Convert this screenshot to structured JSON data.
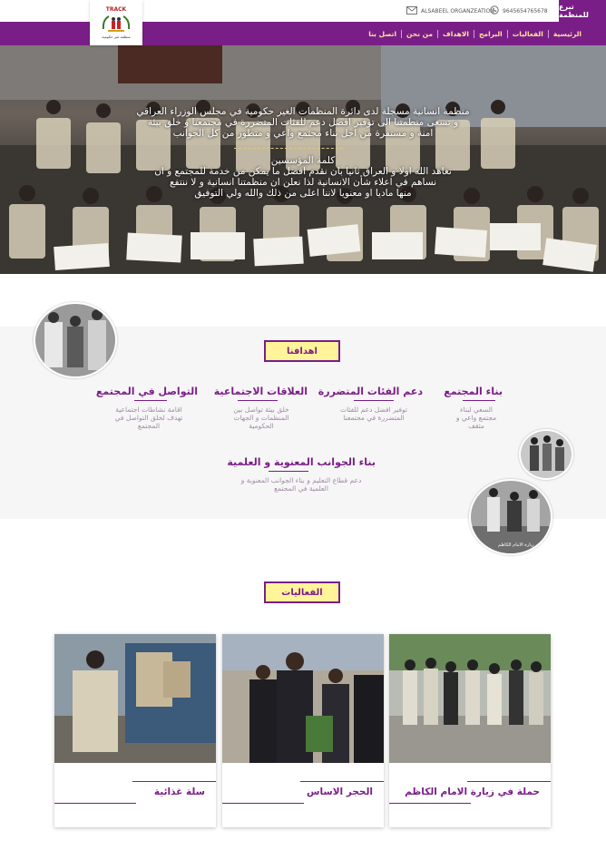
{
  "header": {
    "donate_label": "تبرع للمنظمة",
    "phone": "9645654765678",
    "email": "ALSABEEL ORGANZEATION",
    "logo_text": "TRACK",
    "logo_subtext": "منظمة غير حكومية"
  },
  "nav": {
    "items": [
      "الرئيسية",
      "الفعاليات",
      "البرامج",
      "الاهداف",
      "من نحن",
      "اتصل بنا"
    ]
  },
  "hero": {
    "mission_lines": [
      "منظمة انسانية مسجلة لدى دائرة المنظمات الغير حكومية في مجلس الوزراء العراقي",
      "و تسعى منظمتنا الى توفير افضل دعم للفئات المتضررة في مجتمعنا و خلق بيئة",
      "امنة و مستقرة من اجل بناء مجتمع واعي و متطور من كل الجوانب"
    ],
    "founder_title": "كلمة المؤسسين",
    "founder_lines": [
      "نعاهد الله اولا و العراق ثانيا بان نقدم افضل ما يمكن من خدمة للمجتمع و ان",
      "نساهم في اعلاء شأن الانسانية لذا نعلن ان منظمتنا انسانية و لا ننتفع",
      "منها ماديا او معنويا لاننا اعلى من ذلك والله ولي التوفيق"
    ]
  },
  "goals": {
    "section_label": "اهدافنا",
    "items": [
      {
        "title": "بناء المجتمع",
        "desc": [
          "السعي لبناء",
          "مجتمع واعي و",
          "مثقف"
        ]
      },
      {
        "title": "دعم الفئات المتضررة",
        "desc": [
          "توفير افضل دعم للفئات",
          "المتضررة في مجتمعنا"
        ]
      },
      {
        "title": "العلاقات الاجتماعية",
        "desc": [
          "خلق بيئة تواصل بين",
          "المنظمات و الجهات",
          "الحكومية"
        ]
      },
      {
        "title": "التواصل في المجتمع",
        "desc": [
          "اقامة نشاطات اجتماعية",
          "تهدف لخلق التواصل في",
          "المجتمع"
        ]
      },
      {
        "title": "بناء الجوانب المعنوية و العلمية",
        "desc": [
          "دعم قطاع التعليم و بناء الجوانب المعنوية و",
          "العلمية في المجتمع"
        ]
      }
    ],
    "circle_caption": "زيارة الامام الكاظم"
  },
  "events": {
    "section_label": "الفعاليات",
    "cards": [
      {
        "title": "سلة غذائية"
      },
      {
        "title": "الحجر الاساس"
      },
      {
        "title": "حملة في زيارة الامام الكاظم"
      }
    ]
  },
  "colors": {
    "brand_purple": "#7a1e87",
    "tab_yellow": "#fff49a",
    "nav_text": "#ffe39a"
  }
}
